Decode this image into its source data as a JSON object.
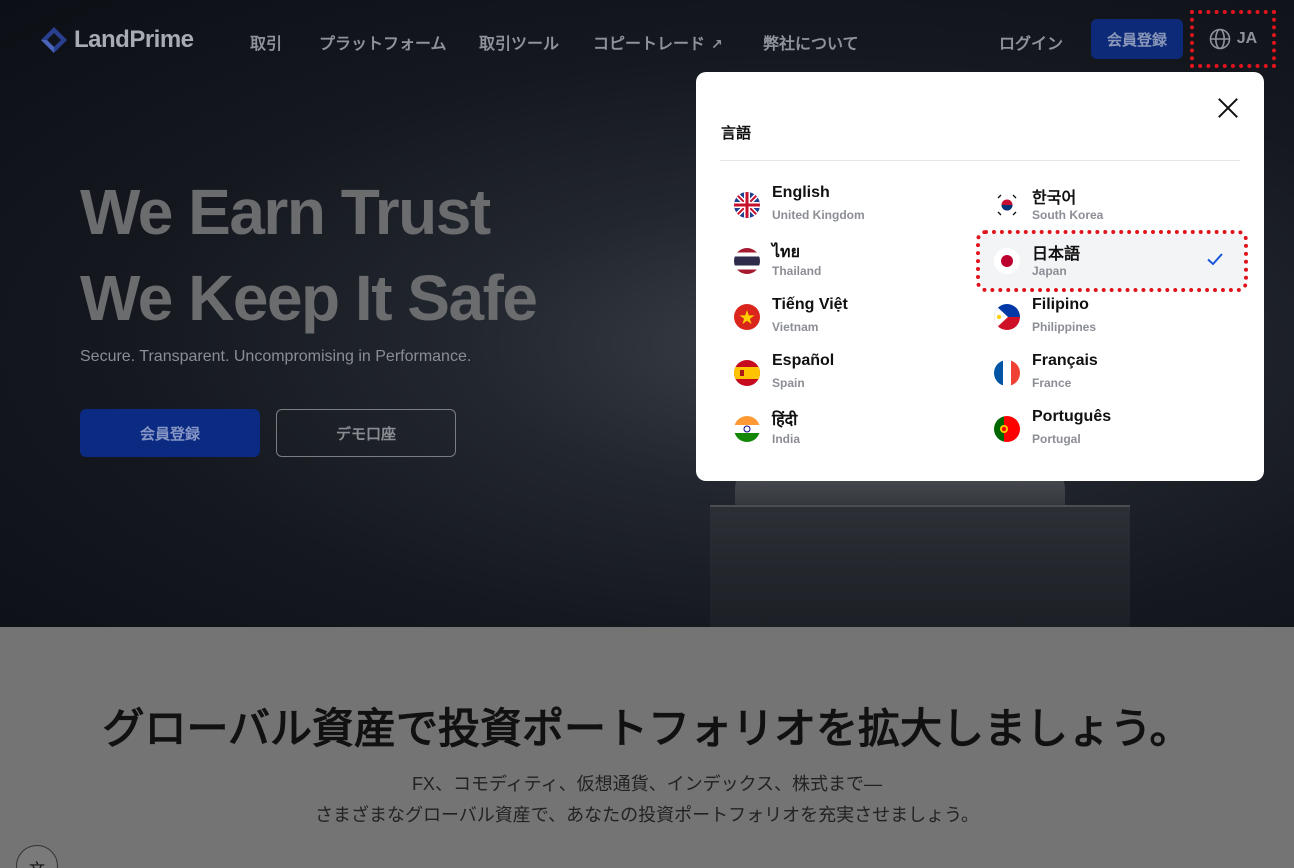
{
  "nav": {
    "logo_text": "LandPrime",
    "links": [
      "取引",
      "プラットフォーム",
      "取引ツール",
      "コピートレード",
      "弊社について"
    ],
    "copy_trade_ext": "↗",
    "login": "ログイン",
    "register": "会員登録",
    "lang_code": "JA"
  },
  "hero": {
    "title_line1": "We Earn Trust",
    "title_line2": "We Keep It Safe",
    "subtitle": "Secure. Transparent. Uncompromising in Performance.",
    "register_button": "会員登録",
    "demo_button": "デモ口座"
  },
  "lower": {
    "title": "グローバル資産で投資ポートフォリオを拡大しましょう。",
    "line1": "FX、コモディティ、仮想通貨、インデックス、株式まで—",
    "line2": "さまざまなグローバル資産で、あなたの投資ポートフォリオを充実させましょう。",
    "fab_icon": "文"
  },
  "language_modal": {
    "title": "言語",
    "selected": "日本語",
    "languages": [
      {
        "name": "English",
        "country": "United Kingdom",
        "flag": "uk-flag"
      },
      {
        "name": "한국어",
        "country": "South Korea",
        "flag": "kr-flag"
      },
      {
        "name": "ไทย",
        "country": "Thailand",
        "flag": "th-flag"
      },
      {
        "name": "日本語",
        "country": "Japan",
        "flag": "jp-flag"
      },
      {
        "name": "Tiếng Việt",
        "country": "Vietnam",
        "flag": "vn-flag"
      },
      {
        "name": "Filipino",
        "country": "Philippines",
        "flag": "ph-flag"
      },
      {
        "name": "Español",
        "country": "Spain",
        "flag": "es-flag"
      },
      {
        "name": "Français",
        "country": "France",
        "flag": "fr-flag"
      },
      {
        "name": "हिंदी",
        "country": "India",
        "flag": "in-flag"
      },
      {
        "name": "Português",
        "country": "Portugal",
        "flag": "pt-flag"
      }
    ]
  },
  "colors": {
    "accent": "#0b2a82",
    "highlight": "#e0141c",
    "check": "#1a56db"
  }
}
